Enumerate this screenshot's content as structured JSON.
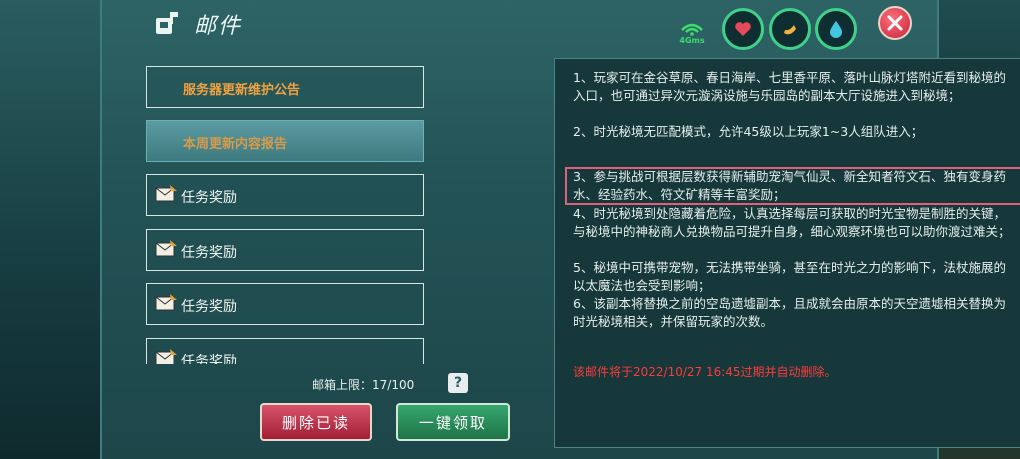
{
  "header": {
    "title": "邮件",
    "signal_label": "4Gms"
  },
  "mail_list": [
    {
      "label": "服务器更新维护公告",
      "style": "notice"
    },
    {
      "label": "本周更新内容报告",
      "style": "selected"
    },
    {
      "label": "任务奖励",
      "style": "reward"
    },
    {
      "label": "任务奖励",
      "style": "reward"
    },
    {
      "label": "任务奖励",
      "style": "reward"
    },
    {
      "label": "任务奖励",
      "style": "reward"
    }
  ],
  "footer": {
    "mailbox_limit": "邮箱上限：17/100",
    "help": "?",
    "delete_read": "删除已读",
    "claim_all": "一键领取"
  },
  "content": {
    "paragraphs": [
      "1、玩家可在金谷草原、春日海岸、七里香平原、落叶山脉灯塔附近看到秘境的入口，也可通过异次元漩涡设施与乐园岛的副本大厅设施进入到秘境；",
      "2、时光秘境无匹配模式，允许45级以上玩家1~3人组队进入；",
      "3、参与挑战可根据层数获得新辅助宠淘气仙灵、新全知者符文石、独有变身药水、经验药水、符文矿精等丰富奖励；",
      "4、时光秘境到处隐藏着危险，认真选择每层可获取的时光宝物是制胜的关键，与秘境中的神秘商人兑换物品可提升自身，细心观察环境也可以助你渡过难关；",
      "5、秘境中可携带宠物，无法携带坐骑，甚至在时光之力的影响下，法杖施展的以太魔法也会受到影响；",
      "6、该副本将替换之前的空岛遗墟副本，且成就会由原本的天空遗墟相关替换为时光秘境相关，并保留玩家的次数。"
    ],
    "expire_notice": "该邮件将于2022/10/27 16:45过期并自动删除。"
  },
  "colors": {
    "highlight_box": "#e0607b",
    "expire_text": "#ff3a3a",
    "notice_text": "#f0a243"
  }
}
